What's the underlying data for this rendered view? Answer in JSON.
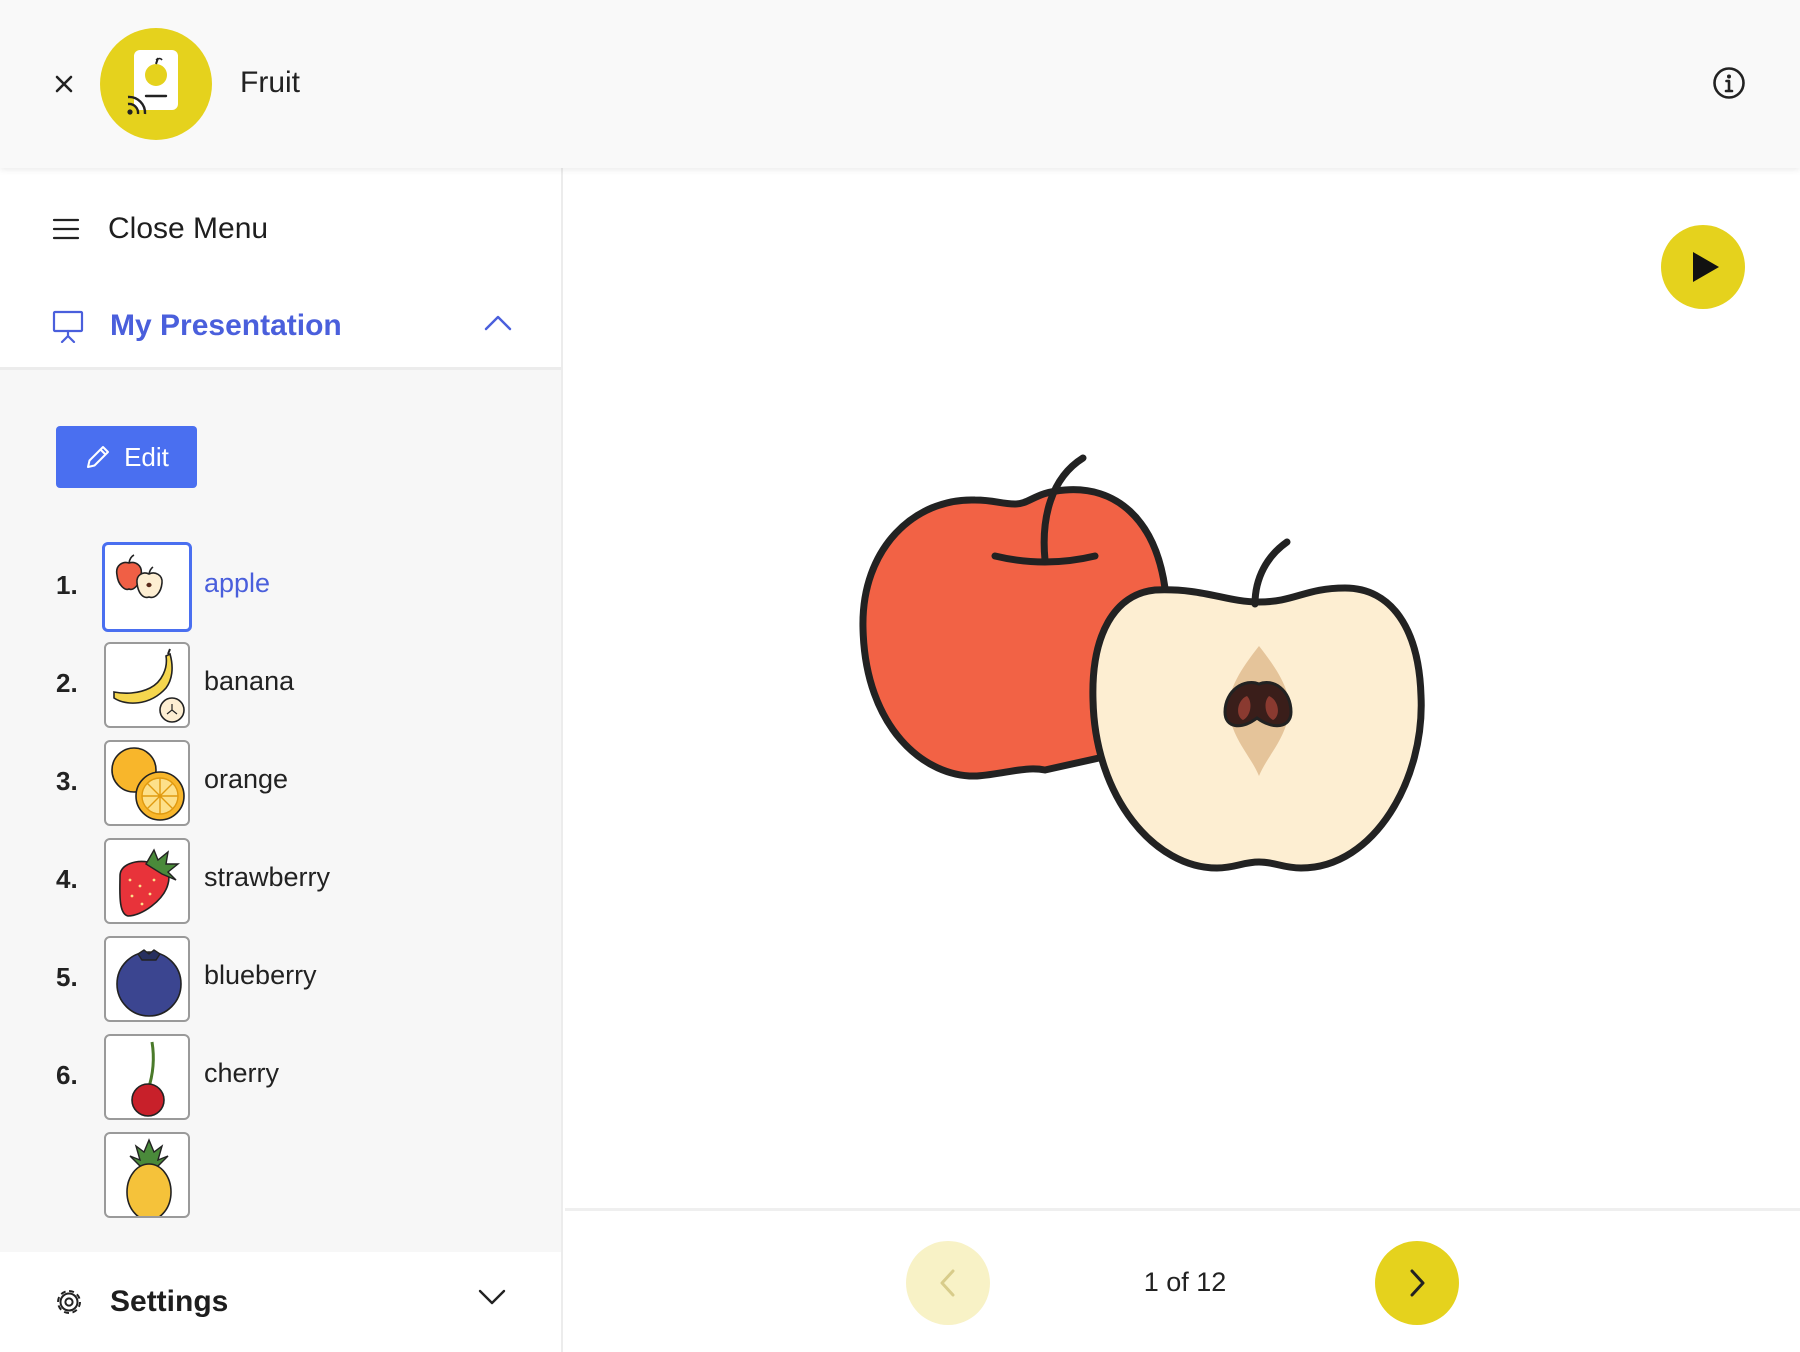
{
  "header": {
    "title": "Fruit",
    "close_icon": "close-icon",
    "info_icon": "info-icon",
    "logo_color": "#e5d21d"
  },
  "sidebar": {
    "menu_label": "Close Menu",
    "presentation_label": "My Presentation",
    "edit_label": "Edit",
    "settings_label": "Settings",
    "accent_color": "#4a5fdc",
    "slides": [
      {
        "number": "1.",
        "label": "apple",
        "icon": "apple-icon",
        "active": true
      },
      {
        "number": "2.",
        "label": "banana",
        "icon": "banana-icon"
      },
      {
        "number": "3.",
        "label": "orange",
        "icon": "orange-icon"
      },
      {
        "number": "4.",
        "label": "strawberry",
        "icon": "strawberry-icon"
      },
      {
        "number": "5.",
        "label": "blueberry",
        "icon": "blueberry-icon"
      },
      {
        "number": "6.",
        "label": "cherry",
        "icon": "cherry-icon"
      },
      {
        "number": "",
        "label": "",
        "icon": "pineapple-icon"
      }
    ]
  },
  "main": {
    "page_indicator": "1 of 12",
    "current_image": "apple-illustration",
    "button_color": "#e5d21d"
  }
}
